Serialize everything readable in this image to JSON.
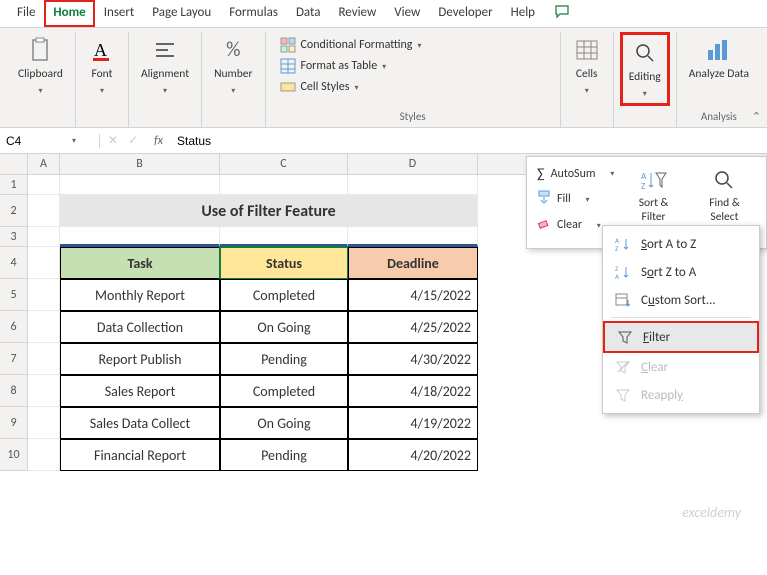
{
  "tabs": [
    "File",
    "Home",
    "Insert",
    "Page Layou",
    "Formulas",
    "Data",
    "Review",
    "View",
    "Developer",
    "Help"
  ],
  "ribbon": {
    "clipboard": "Clipboard",
    "font": "Font",
    "alignment": "Alignment",
    "number": "Number",
    "styles": "Styles",
    "styles_items": {
      "cf": "Conditional Formatting",
      "fat": "Format as Table",
      "cs": "Cell Styles"
    },
    "cells": "Cells",
    "editing": "Editing",
    "analyze": "Analyze Data",
    "analysis": "Analysis"
  },
  "namebox": "C4",
  "formula": "Status",
  "editing_panel": {
    "autosum": "AutoSum",
    "fill": "Fill",
    "clear": "Clear",
    "sortfilter": "Sort & Filter",
    "findselect": "Find & Select"
  },
  "sf_menu": {
    "sortaz": "Sort A to Z",
    "sortza": "Sort Z to A",
    "custom": "Custom Sort...",
    "filter": "Filter",
    "clear": "Clear",
    "reapply": "Reapply"
  },
  "sheet": {
    "title": "Use of Filter Feature",
    "headers": {
      "task": "Task",
      "status": "Status",
      "deadline": "Deadline"
    },
    "rows": [
      {
        "task": "Monthly Report",
        "status": "Completed",
        "deadline": "4/15/2022"
      },
      {
        "task": "Data Collection",
        "status": "On Going",
        "deadline": "4/25/2022"
      },
      {
        "task": "Report Publish",
        "status": "Pending",
        "deadline": "4/30/2022"
      },
      {
        "task": "Sales Report",
        "status": "Completed",
        "deadline": "4/18/2022"
      },
      {
        "task": "Sales Data Collect",
        "status": "On Going",
        "deadline": "4/19/2022"
      },
      {
        "task": "Financial Report",
        "status": "Pending",
        "deadline": "4/20/2022"
      }
    ]
  },
  "watermark": "exceldemy"
}
